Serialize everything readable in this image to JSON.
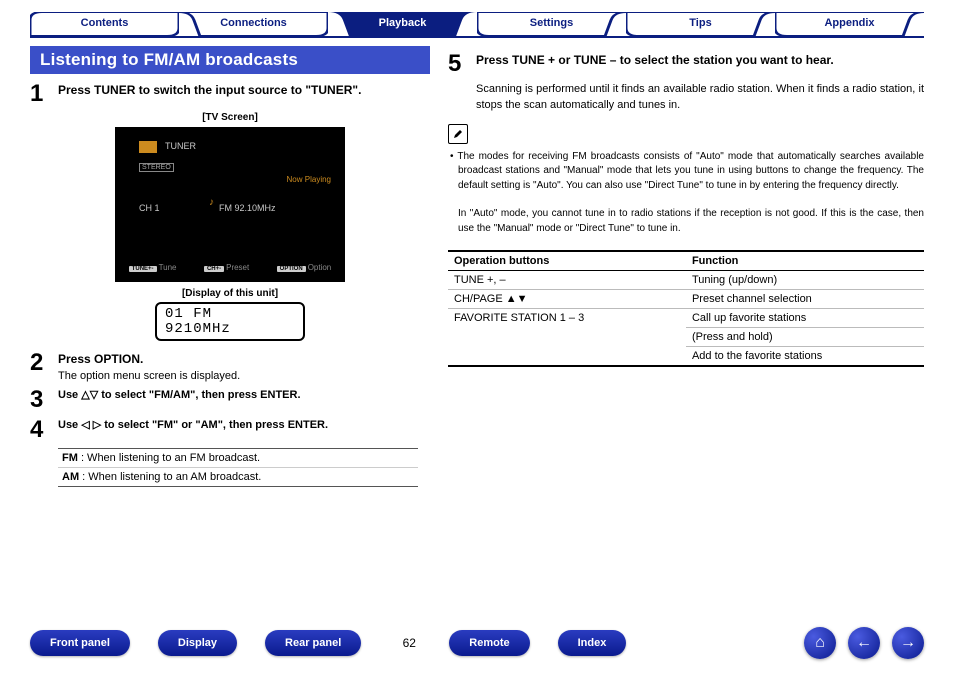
{
  "nav": {
    "tabs": [
      "Contents",
      "Connections",
      "Playback",
      "Settings",
      "Tips",
      "Appendix"
    ],
    "activeIndex": 2
  },
  "heading": "Listening to FM/AM broadcasts",
  "steps": {
    "s1": {
      "num": "1",
      "title": "Press TUNER to switch the input source to \"TUNER\"."
    },
    "s2": {
      "num": "2",
      "title": "Press OPTION.",
      "desc": "The option menu screen is displayed."
    },
    "s3": {
      "num": "3",
      "title": "Use △▽ to select \"FM/AM\", then press ENTER."
    },
    "s4": {
      "num": "4",
      "title": "Use ◁ ▷ to select \"FM\" or \"AM\", then press ENTER."
    },
    "s5": {
      "num": "5",
      "title": "Press TUNE + or TUNE – to select the station you want to hear."
    }
  },
  "tvLabel": "[TV Screen]",
  "tv": {
    "tuner": "TUNER",
    "stereo": "STEREO",
    "np": "Now Playing",
    "ch": "CH 1",
    "ant": "♪",
    "freq": "FM 92.10MHz",
    "f1": "Tune",
    "f2": "Preset",
    "f3": "Option",
    "b1": "TUNE+-",
    "b2": "CH+-",
    "b3": "OPTION"
  },
  "dispLabel": "[Display of this unit]",
  "lcd": {
    "l1": "01 FM",
    "l2": "9210MHz"
  },
  "fmam": {
    "r1a": "FM",
    "r1b": " : When listening to an FM broadcast.",
    "r2a": "AM",
    "r2b": " : When listening to an AM broadcast."
  },
  "scanPara": "Scanning is performed until it finds an available radio station. When it finds a radio station, it stops the scan automatically and tunes in.",
  "noteBullet": "• The modes for receiving FM broadcasts consists of \"Auto\" mode that automatically searches available broadcast stations and \"Manual\" mode that lets you tune in using buttons to change the frequency. The default setting is \"Auto\". You can also use \"Direct Tune\" to tune in by entering the frequency directly.",
  "note2": "In \"Auto\" mode, you cannot tune in to radio stations if the reception is not good. If this is the case, then use the \"Manual\" mode or \"Direct Tune\" to tune in.",
  "optable": {
    "h1": "Operation buttons",
    "h2": "Function",
    "r1a": "TUNE +, –",
    "r1b": "Tuning (up/down)",
    "r2a": "CH/PAGE ▲▼",
    "r2b": "Preset channel selection",
    "r3a": "FAVORITE STATION 1 – 3",
    "r3b": "Call up favorite stations",
    "r3c": "(Press and hold)",
    "r3d": "Add to the favorite stations"
  },
  "footer": {
    "btns": [
      "Front panel",
      "Display",
      "Rear panel",
      "Remote",
      "Index"
    ],
    "page": "62"
  }
}
